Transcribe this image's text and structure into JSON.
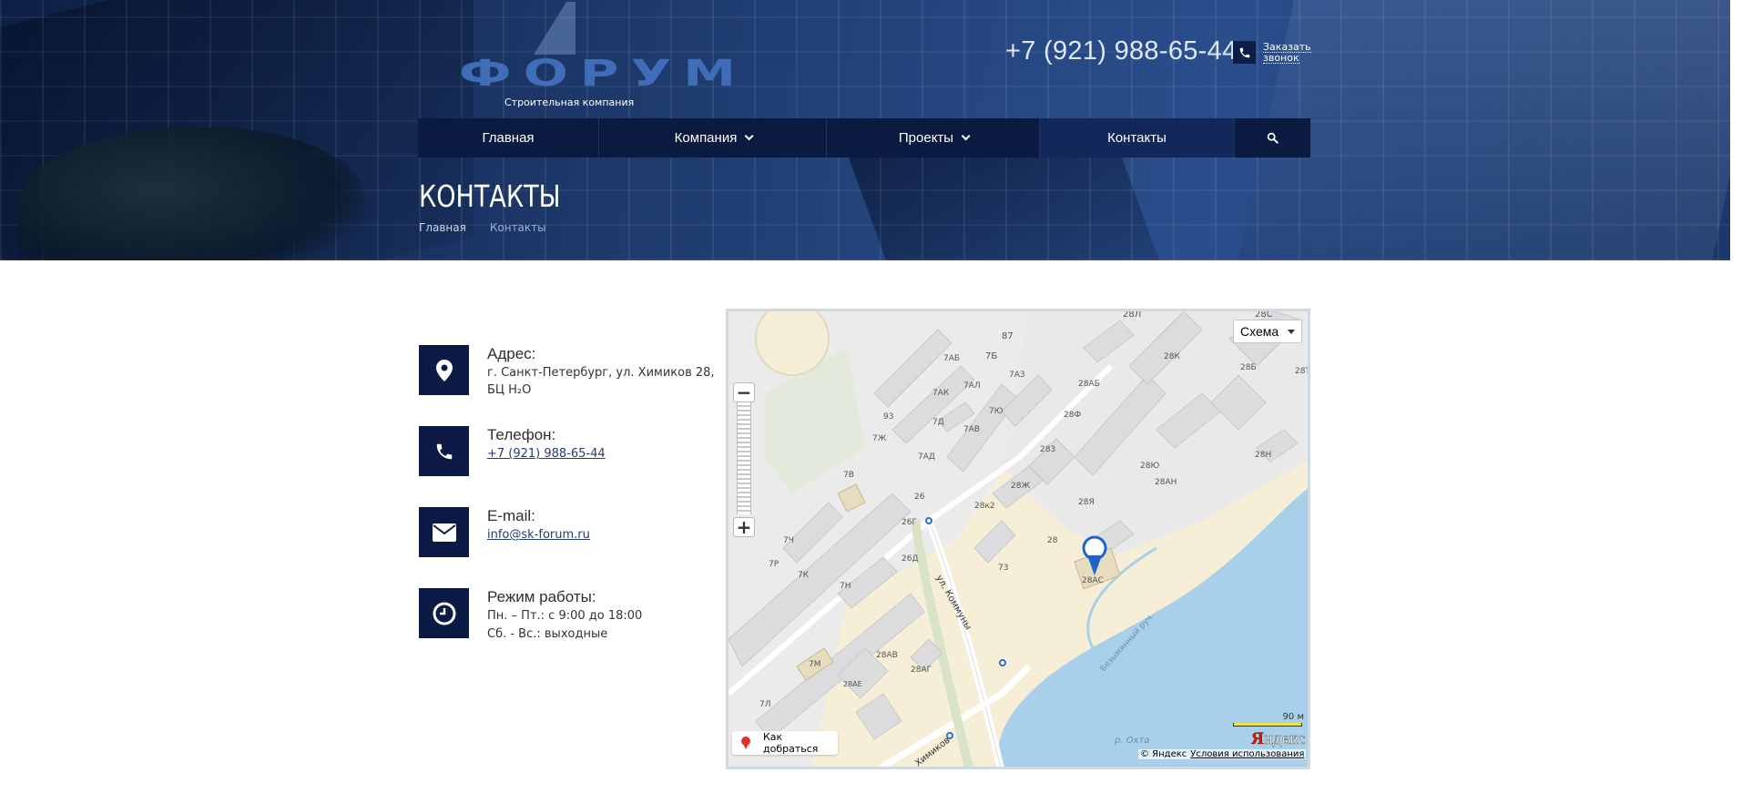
{
  "header": {
    "logo_text": "ФОРУМ",
    "logo_subtitle": "Строительная компания",
    "phone": "+7 (921) 988-65-44",
    "callback_line1": "Заказать",
    "callback_line2": "звонок"
  },
  "nav": {
    "items": [
      {
        "label": "Главная",
        "has_dropdown": false
      },
      {
        "label": "Компания",
        "has_dropdown": true
      },
      {
        "label": "Проекты",
        "has_dropdown": true
      },
      {
        "label": "Контакты",
        "has_dropdown": false,
        "active": true
      }
    ],
    "search_icon": "search-icon"
  },
  "page": {
    "title": "КОНТАКТЫ",
    "breadcrumb": [
      "Главная",
      "Контакты"
    ]
  },
  "contacts": {
    "address": {
      "title": "Адрес:",
      "line1": "г. Санкт-Петербург, ул. Химиков 28,",
      "line2": "БЦ H₂O",
      "icon": "map-pin-icon"
    },
    "phone": {
      "title": "Телефон:",
      "value": "+7 (921) 988-65-44",
      "icon": "phone-icon"
    },
    "email": {
      "title": "E-mail:",
      "value": "info@sk-forum.ru",
      "icon": "envelope-icon"
    },
    "hours": {
      "title": "Режим работы:",
      "line1": "Пн. – Пт.: с 9:00 до 18:00",
      "line2": "Сб. - Вс.: выходные",
      "icon": "clock-icon"
    }
  },
  "map": {
    "type_selector": "Схема",
    "route_button": "Как добраться",
    "scale_label": "90 м",
    "logo": "Яндекс",
    "copyright": "© Яндекс",
    "terms_link": "Условия использования",
    "labels": [
      "28Л",
      "28С",
      "87",
      "7Б",
      "7АБ",
      "7АЗ",
      "7АЛ",
      "7АК",
      "28К",
      "28Б",
      "28Т",
      "28АБ",
      "7Ю",
      "7Д",
      "93",
      "7АВ",
      "28Ф",
      "7Ж",
      "283",
      "7АД",
      "28Ю",
      "28Н",
      "28АН",
      "7В",
      "28Ж",
      "28Я",
      "26",
      "28к2",
      "7Ч",
      "26Г",
      "28",
      "28АС",
      "7Р",
      "7К",
      "26Д",
      "73",
      "7Н",
      "ул. Коммуны",
      "Безымянный руч.",
      "7М",
      "28АВ",
      "28АГ",
      "28АЕ",
      "7Л",
      "р. Охта",
      "Химиков"
    ],
    "colors": {
      "land": "#f6eed7",
      "water": "#a8d0ea",
      "building": "#dcdcde",
      "park": "#e4ebd9"
    }
  }
}
